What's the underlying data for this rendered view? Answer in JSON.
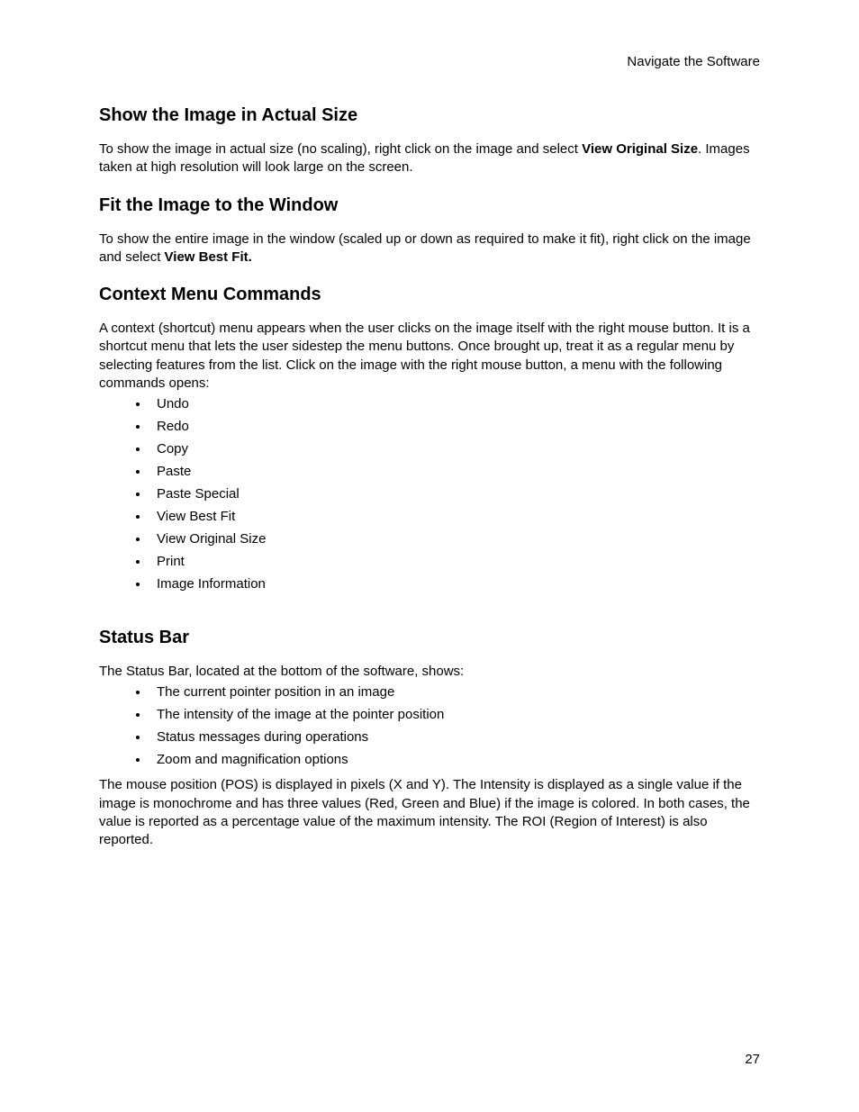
{
  "header": "Navigate the Software",
  "sec1": {
    "heading": "Show the Image in Actual Size",
    "p_a": "To show the image in actual size (no scaling), right click on the image and select ",
    "p_bold": "View Original Size",
    "p_b": ". Images taken at high resolution will look large on the screen."
  },
  "sec2": {
    "heading": "Fit the Image to the Window",
    "p_a": "To show the entire image in the window (scaled up or down as required to make it fit), right click on the image and select ",
    "p_bold": "View Best Fit."
  },
  "sec3": {
    "heading": "Context Menu Commands",
    "p": "A context (shortcut) menu appears when the user clicks on the image itself with the right mouse button. It is a shortcut menu that lets the user sidestep the menu buttons. Once brought up, treat it as a regular menu by selecting features from the list. Click on the image with the right mouse button, a menu with the following commands opens:",
    "items": [
      "Undo",
      "Redo",
      "Copy",
      "Paste",
      "Paste Special",
      "View Best Fit",
      "View Original Size",
      "Print",
      "Image Information"
    ]
  },
  "sec4": {
    "heading": "Status Bar",
    "p1": "The Status Bar, located at the bottom of the software, shows:",
    "items": [
      "The current pointer position in an image",
      "The intensity of the image at the pointer position",
      "Status messages during operations",
      "Zoom and magnification options"
    ],
    "p2": "The mouse position (POS) is displayed in pixels (X and Y). The Intensity is displayed as a single value if the image is monochrome and has three values (Red, Green and Blue) if the image is colored. In both cases, the value is reported as a percentage value of the maximum intensity. The ROI (Region of Interest) is also reported."
  },
  "pageNumber": "27"
}
